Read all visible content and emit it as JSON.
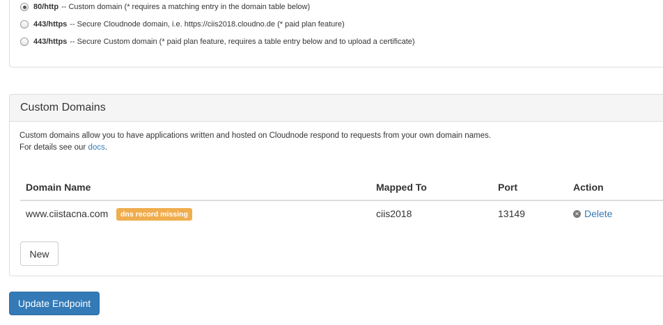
{
  "endpoint_options": [
    {
      "port": "80/http",
      "text": "-- Custom domain (* requires a matching entry in the domain table below)",
      "checked": true
    },
    {
      "port": "443/https",
      "text": "-- Secure Cloudnode domain, i.e. https://ciis2018.cloudno.de (* paid plan feature)",
      "checked": false
    },
    {
      "port": "443/https",
      "text": "-- Secure Custom domain (* paid plan feature, requires a table entry below and to upload a certificate)",
      "checked": false
    }
  ],
  "custom_domains": {
    "title": "Custom Domains",
    "description_line1": "Custom domains allow you to have applications written and hosted on Cloudnode respond to requests from your own domain names.",
    "description_line2_prefix": "For details see our ",
    "docs_link": "docs",
    "description_line2_suffix": ".",
    "columns": {
      "domain_name": "Domain Name",
      "mapped_to": "Mapped To",
      "port": "Port",
      "action": "Action"
    },
    "rows": [
      {
        "domain": "www.ciistacna.com",
        "badge": "dns record missing",
        "mapped_to": "ciis2018",
        "port": "13149",
        "action_label": "Delete"
      }
    ],
    "new_button": "New"
  },
  "update_button": "Update Endpoint",
  "colors": {
    "primary": "#337ab7",
    "warning": "#f0ad4e",
    "border": "#dddddd"
  }
}
